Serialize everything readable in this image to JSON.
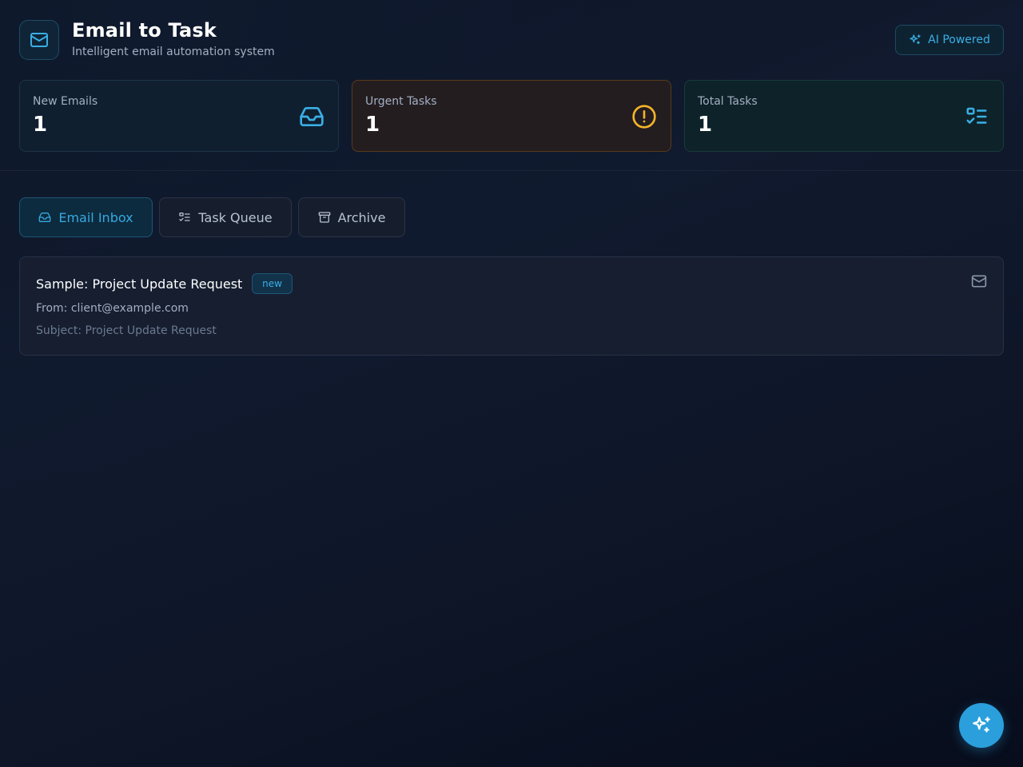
{
  "header": {
    "title": "Email to Task",
    "subtitle": "Intelligent email automation system",
    "logo_icon": "mail-icon",
    "badge_label": "AI Powered",
    "badge_icon": "sparkles-icon"
  },
  "stats": [
    {
      "label": "New Emails",
      "value": "1",
      "icon": "inbox-icon",
      "accent": "#3aaee4"
    },
    {
      "label": "Urgent Tasks",
      "value": "1",
      "icon": "alert-circle-icon",
      "accent": "#f5b429"
    },
    {
      "label": "Total Tasks",
      "value": "1",
      "icon": "list-checks-icon",
      "accent": "#3aaee4"
    }
  ],
  "tabs": [
    {
      "label": "Email Inbox",
      "icon": "inbox-icon",
      "active": true
    },
    {
      "label": "Task Queue",
      "icon": "list-checks-icon",
      "active": false
    },
    {
      "label": "Archive",
      "icon": "archive-icon",
      "active": false
    }
  ],
  "emails": [
    {
      "title": "Sample: Project Update Request",
      "badge": "new",
      "from": "From: client@example.com",
      "subject": "Subject: Project Update Request",
      "icon": "mail-icon"
    }
  ],
  "fab": {
    "icon": "sparkles-icon"
  },
  "colors": {
    "accent": "#2a9fdc",
    "warning": "#f5b429",
    "background": "#0d1424"
  }
}
